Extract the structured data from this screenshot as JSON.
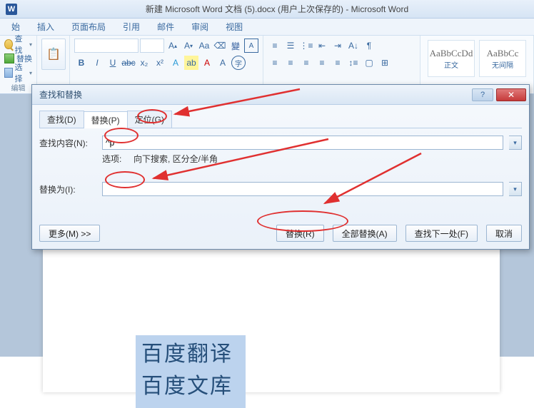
{
  "app": {
    "title": "新建 Microsoft Word 文档 (5).docx (用户上次保存的) - Microsoft Word"
  },
  "menu": {
    "tabs": [
      "始",
      "插入",
      "页面布局",
      "引用",
      "邮件",
      "审阅",
      "视图"
    ]
  },
  "ribbon": {
    "edit": {
      "find": "查找",
      "replace": "替换",
      "select": "选择",
      "group": "编辑"
    },
    "font": {
      "size_up": "A",
      "group": ""
    },
    "styles": {
      "s1_sample": "AaBbCcDd",
      "s1_name": "正文",
      "s2_sample": "AaBbCc",
      "s2_name": "无间隔"
    }
  },
  "dialog": {
    "title": "查找和替换",
    "tabs": {
      "find": "查找(D)",
      "replace": "替换(P)",
      "goto": "定位(G)"
    },
    "find_label": "查找内容(N):",
    "find_value": "^p",
    "options_label": "选项:",
    "options_value": "向下搜索, 区分全/半角",
    "replace_label": "替换为(I):",
    "replace_value": "",
    "more_btn": "更多(M) >>",
    "replace_btn": "替换(R)",
    "replace_all_btn": "全部替换(A)",
    "find_next_btn": "查找下一处(F)",
    "cancel_btn": "取消"
  },
  "doc": {
    "line1": "百度翻译",
    "line2": "百度文库"
  }
}
